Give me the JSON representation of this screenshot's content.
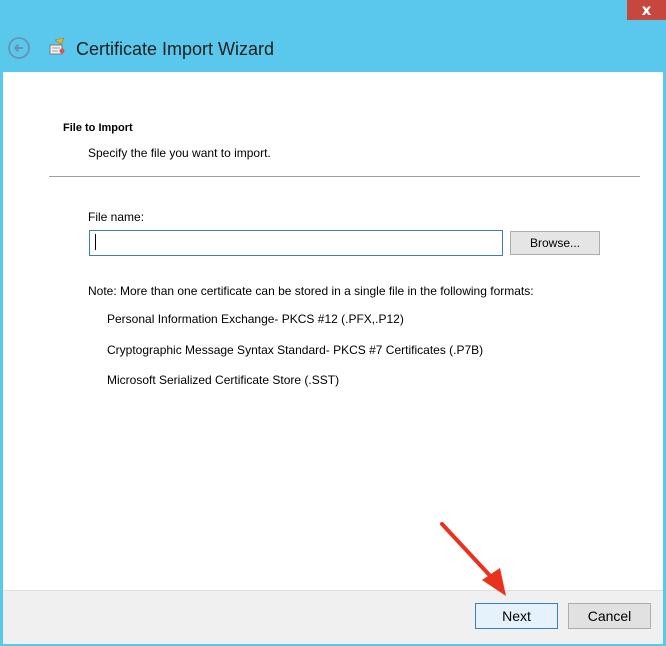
{
  "window": {
    "title": "Certificate Import Wizard",
    "close_glyph": "x",
    "frame_color": "#5ac8ec",
    "close_color": "#c7463d"
  },
  "icons": {
    "back": "back-arrow-icon",
    "wizard": "certificate-wizard-icon",
    "annotation": "red-arrow-annotation"
  },
  "section": {
    "title": "File to Import",
    "subtitle": "Specify the file you want to import."
  },
  "file_field": {
    "label": "File name:",
    "value": "",
    "browse_label": "Browse..."
  },
  "note": {
    "text": "Note:  More than one certificate can be stored in a single file in the following formats:",
    "formats": [
      "Personal Information Exchange- PKCS #12 (.PFX,.P12)",
      "Cryptographic Message Syntax Standard- PKCS #7 Certificates (.P7B)",
      "Microsoft Serialized Certificate Store (.SST)"
    ]
  },
  "footer": {
    "next_label": "Next",
    "cancel_label": "Cancel"
  }
}
